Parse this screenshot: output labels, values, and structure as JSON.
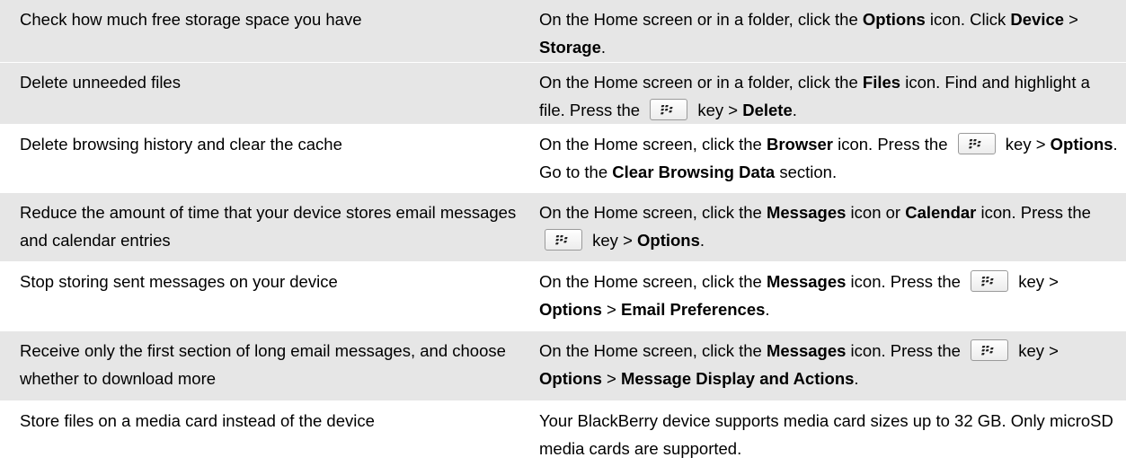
{
  "rows": [
    {
      "task": "Check how much free storage space you have",
      "how": [
        {
          "t": "On the Home screen or in a folder, click the "
        },
        {
          "b": "Options"
        },
        {
          "t": " icon. Click "
        },
        {
          "b": "Device"
        },
        {
          "t": " > "
        },
        {
          "b": "Storage"
        },
        {
          "t": "."
        }
      ]
    },
    {
      "task": "Delete unneeded files",
      "how": [
        {
          "t": "On the Home screen or in a folder, click the "
        },
        {
          "b": "Files"
        },
        {
          "t": " icon. Find and highlight a file. Press the "
        },
        {
          "key": "menu-key-icon"
        },
        {
          "t": " key > "
        },
        {
          "b": "Delete"
        },
        {
          "t": "."
        }
      ]
    },
    {
      "task": "Delete browsing history and clear the cache",
      "how": [
        {
          "t": "On the Home screen, click the "
        },
        {
          "b": "Browser"
        },
        {
          "t": " icon. Press the "
        },
        {
          "key": "menu-key-icon"
        },
        {
          "t": " key > "
        },
        {
          "b": "Options"
        },
        {
          "t": ". Go to the "
        },
        {
          "b": "Clear Browsing Data"
        },
        {
          "t": " section."
        }
      ]
    },
    {
      "task": "Reduce the amount of time that your device stores email messages and calendar entries",
      "how": [
        {
          "t": "On the Home screen, click the "
        },
        {
          "b": "Messages"
        },
        {
          "t": " icon or "
        },
        {
          "b": "Calendar"
        },
        {
          "t": " icon. Press the "
        },
        {
          "key": "menu-key-icon"
        },
        {
          "t": " key > "
        },
        {
          "b": "Options"
        },
        {
          "t": "."
        }
      ]
    },
    {
      "task": "Stop storing sent messages on your device",
      "how": [
        {
          "t": "On the Home screen, click the "
        },
        {
          "b": "Messages"
        },
        {
          "t": " icon. Press the "
        },
        {
          "key": "menu-key-icon"
        },
        {
          "t": " key > "
        },
        {
          "b": "Options"
        },
        {
          "t": " > "
        },
        {
          "b": "Email Preferences"
        },
        {
          "t": "."
        }
      ]
    },
    {
      "task": "Receive only the first section of long email messages, and choose whether to download more",
      "how": [
        {
          "t": "On the Home screen, click the "
        },
        {
          "b": "Messages"
        },
        {
          "t": " icon. Press the "
        },
        {
          "key": "menu-key-icon"
        },
        {
          "t": " key > "
        },
        {
          "b": "Options"
        },
        {
          "t": " > "
        },
        {
          "b": "Message Display and Actions"
        },
        {
          "t": "."
        }
      ]
    },
    {
      "task": "Store files on a media card instead of the device",
      "how": [
        {
          "t": "Your BlackBerry device supports media card sizes up to 32 GB. Only microSD media cards are supported."
        }
      ]
    }
  ]
}
